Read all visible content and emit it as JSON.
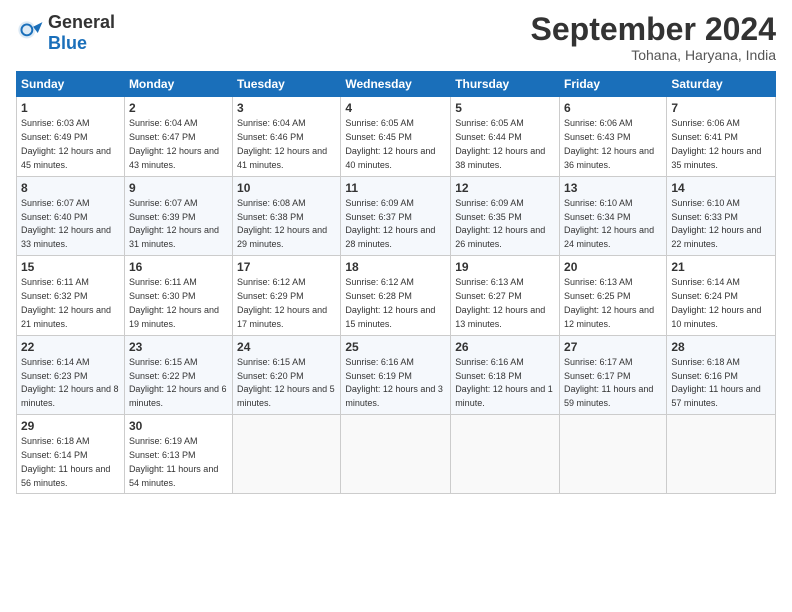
{
  "header": {
    "logo_general": "General",
    "logo_blue": "Blue",
    "month_title": "September 2024",
    "subtitle": "Tohana, Haryana, India"
  },
  "days_of_week": [
    "Sunday",
    "Monday",
    "Tuesday",
    "Wednesday",
    "Thursday",
    "Friday",
    "Saturday"
  ],
  "weeks": [
    [
      {
        "day": "1",
        "sunrise": "6:03 AM",
        "sunset": "6:49 PM",
        "daylight": "12 hours and 45 minutes."
      },
      {
        "day": "2",
        "sunrise": "6:04 AM",
        "sunset": "6:47 PM",
        "daylight": "12 hours and 43 minutes."
      },
      {
        "day": "3",
        "sunrise": "6:04 AM",
        "sunset": "6:46 PM",
        "daylight": "12 hours and 41 minutes."
      },
      {
        "day": "4",
        "sunrise": "6:05 AM",
        "sunset": "6:45 PM",
        "daylight": "12 hours and 40 minutes."
      },
      {
        "day": "5",
        "sunrise": "6:05 AM",
        "sunset": "6:44 PM",
        "daylight": "12 hours and 38 minutes."
      },
      {
        "day": "6",
        "sunrise": "6:06 AM",
        "sunset": "6:43 PM",
        "daylight": "12 hours and 36 minutes."
      },
      {
        "day": "7",
        "sunrise": "6:06 AM",
        "sunset": "6:41 PM",
        "daylight": "12 hours and 35 minutes."
      }
    ],
    [
      {
        "day": "8",
        "sunrise": "6:07 AM",
        "sunset": "6:40 PM",
        "daylight": "12 hours and 33 minutes."
      },
      {
        "day": "9",
        "sunrise": "6:07 AM",
        "sunset": "6:39 PM",
        "daylight": "12 hours and 31 minutes."
      },
      {
        "day": "10",
        "sunrise": "6:08 AM",
        "sunset": "6:38 PM",
        "daylight": "12 hours and 29 minutes."
      },
      {
        "day": "11",
        "sunrise": "6:09 AM",
        "sunset": "6:37 PM",
        "daylight": "12 hours and 28 minutes."
      },
      {
        "day": "12",
        "sunrise": "6:09 AM",
        "sunset": "6:35 PM",
        "daylight": "12 hours and 26 minutes."
      },
      {
        "day": "13",
        "sunrise": "6:10 AM",
        "sunset": "6:34 PM",
        "daylight": "12 hours and 24 minutes."
      },
      {
        "day": "14",
        "sunrise": "6:10 AM",
        "sunset": "6:33 PM",
        "daylight": "12 hours and 22 minutes."
      }
    ],
    [
      {
        "day": "15",
        "sunrise": "6:11 AM",
        "sunset": "6:32 PM",
        "daylight": "12 hours and 21 minutes."
      },
      {
        "day": "16",
        "sunrise": "6:11 AM",
        "sunset": "6:30 PM",
        "daylight": "12 hours and 19 minutes."
      },
      {
        "day": "17",
        "sunrise": "6:12 AM",
        "sunset": "6:29 PM",
        "daylight": "12 hours and 17 minutes."
      },
      {
        "day": "18",
        "sunrise": "6:12 AM",
        "sunset": "6:28 PM",
        "daylight": "12 hours and 15 minutes."
      },
      {
        "day": "19",
        "sunrise": "6:13 AM",
        "sunset": "6:27 PM",
        "daylight": "12 hours and 13 minutes."
      },
      {
        "day": "20",
        "sunrise": "6:13 AM",
        "sunset": "6:25 PM",
        "daylight": "12 hours and 12 minutes."
      },
      {
        "day": "21",
        "sunrise": "6:14 AM",
        "sunset": "6:24 PM",
        "daylight": "12 hours and 10 minutes."
      }
    ],
    [
      {
        "day": "22",
        "sunrise": "6:14 AM",
        "sunset": "6:23 PM",
        "daylight": "12 hours and 8 minutes."
      },
      {
        "day": "23",
        "sunrise": "6:15 AM",
        "sunset": "6:22 PM",
        "daylight": "12 hours and 6 minutes."
      },
      {
        "day": "24",
        "sunrise": "6:15 AM",
        "sunset": "6:20 PM",
        "daylight": "12 hours and 5 minutes."
      },
      {
        "day": "25",
        "sunrise": "6:16 AM",
        "sunset": "6:19 PM",
        "daylight": "12 hours and 3 minutes."
      },
      {
        "day": "26",
        "sunrise": "6:16 AM",
        "sunset": "6:18 PM",
        "daylight": "12 hours and 1 minute."
      },
      {
        "day": "27",
        "sunrise": "6:17 AM",
        "sunset": "6:17 PM",
        "daylight": "11 hours and 59 minutes."
      },
      {
        "day": "28",
        "sunrise": "6:18 AM",
        "sunset": "6:16 PM",
        "daylight": "11 hours and 57 minutes."
      }
    ],
    [
      {
        "day": "29",
        "sunrise": "6:18 AM",
        "sunset": "6:14 PM",
        "daylight": "11 hours and 56 minutes."
      },
      {
        "day": "30",
        "sunrise": "6:19 AM",
        "sunset": "6:13 PM",
        "daylight": "11 hours and 54 minutes."
      },
      null,
      null,
      null,
      null,
      null
    ]
  ]
}
